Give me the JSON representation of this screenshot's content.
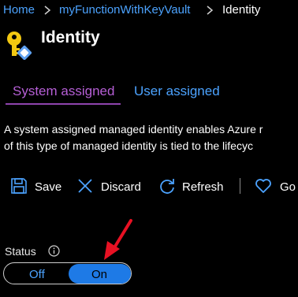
{
  "breadcrumb": {
    "items": [
      {
        "label": "Home"
      },
      {
        "label": "myFunctionWithKeyVault"
      },
      {
        "label": "Identity"
      }
    ]
  },
  "header": {
    "title": "Identity",
    "icon": "key-icon"
  },
  "tabs": [
    {
      "label": "System assigned",
      "active": true
    },
    {
      "label": "User assigned",
      "active": false
    }
  ],
  "description": {
    "line1": "A system assigned managed identity enables Azure r",
    "line2": "of this type of managed identity is tied to the lifecyc"
  },
  "toolbar": {
    "save_label": "Save",
    "discard_label": "Discard",
    "refresh_label": "Refresh",
    "feedback_label": "Go"
  },
  "status": {
    "label": "Status",
    "off_label": "Off",
    "on_label": "On",
    "selected": "On"
  },
  "colors": {
    "link": "#4ca3ff",
    "accent_tab": "#b65fd6",
    "toggle_on": "#1e7ae6",
    "annotation_arrow": "#e81123"
  }
}
